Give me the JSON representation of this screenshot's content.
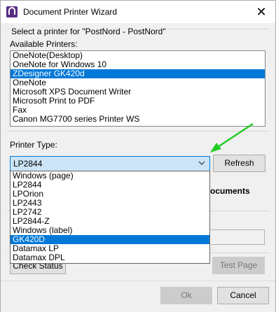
{
  "window": {
    "title": "Document Printer Wizard",
    "icon": "app-logo-icon",
    "close_icon": "close-icon"
  },
  "printer_section": {
    "select_label": "Select a printer for \"PostNord - PostNord\"",
    "available_label": "Available Printers:",
    "printers": [
      {
        "label": "OneNote(Desktop)",
        "selected": false
      },
      {
        "label": "OneNote for Windows 10",
        "selected": false
      },
      {
        "label": "ZDesigner GK420d",
        "selected": true
      },
      {
        "label": "OneNote",
        "selected": false
      },
      {
        "label": "Microsoft XPS Document Writer",
        "selected": false
      },
      {
        "label": "Microsoft Print to PDF",
        "selected": false
      },
      {
        "label": "Fax",
        "selected": false
      },
      {
        "label": "Canon MG7700 series Printer WS",
        "selected": false
      }
    ]
  },
  "printer_type": {
    "label": "Printer Type:",
    "selected_value": "LP2844",
    "refresh_label": "Refresh",
    "options": [
      {
        "label": "Windows (page)",
        "selected": false
      },
      {
        "label": "LP2844",
        "selected": false
      },
      {
        "label": "LPOrion",
        "selected": false
      },
      {
        "label": "LP2443",
        "selected": false
      },
      {
        "label": "LP2742",
        "selected": false
      },
      {
        "label": "LP2844-Z",
        "selected": false
      },
      {
        "label": "Windows (label)",
        "selected": false
      },
      {
        "label": "GK420D",
        "selected": true
      },
      {
        "label": "Datamax LP",
        "selected": false
      },
      {
        "label": "Datamax DPL",
        "selected": false
      }
    ]
  },
  "partial_text": {
    "documents": "ocuments"
  },
  "buttons": {
    "check_status": "Check Status",
    "test_page": "Test Page",
    "ok": "Ok",
    "cancel": "Cancel"
  },
  "colors": {
    "selection": "#0078d7",
    "annotation_arrow": "#22cc22"
  }
}
